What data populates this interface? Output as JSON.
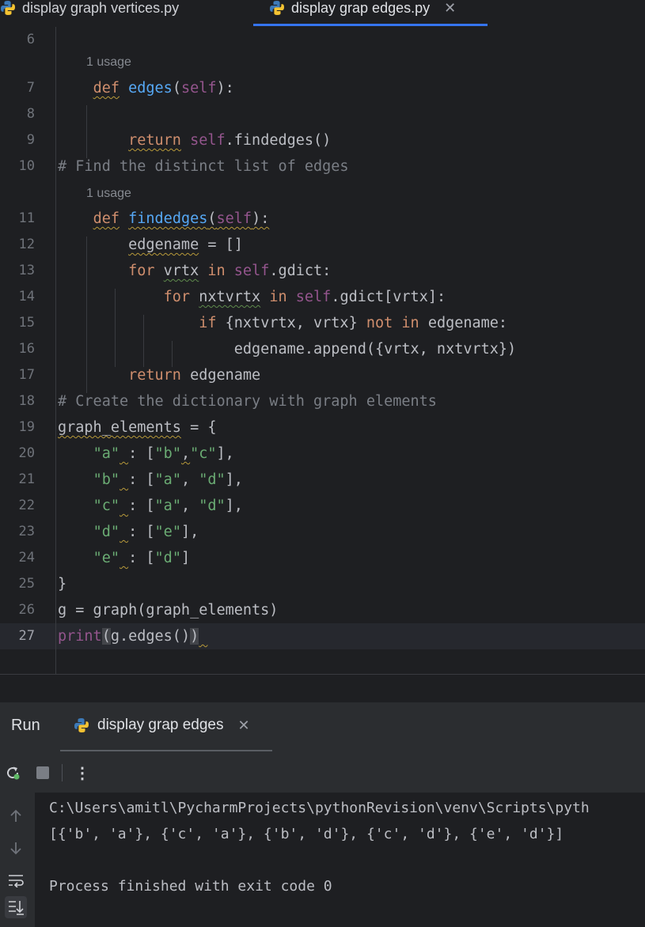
{
  "tabs": [
    {
      "label": "display graph vertices.py"
    },
    {
      "label": "display grap edges.py",
      "active": true
    }
  ],
  "editor": {
    "usage_hint": "1 usage",
    "line_numbers": [
      "6",
      "7",
      "8",
      "9",
      "10",
      "11",
      "12",
      "13",
      "14",
      "15",
      "16",
      "17",
      "18",
      "19",
      "20",
      "21",
      "22",
      "23",
      "24",
      "25",
      "26",
      "27"
    ],
    "comments": {
      "c10": "# Find the distinct list of edges",
      "c18": "# Create the dictionary with graph elements"
    }
  },
  "run_panel": {
    "title": "Run",
    "tab_label": "display grap edges",
    "output": [
      "C:\\Users\\amitl\\PycharmProjects\\pythonRevision\\venv\\Scripts\\pyth",
      "[{'b', 'a'}, {'c', 'a'}, {'b', 'd'}, {'c', 'd'}, {'e', 'd'}]",
      "",
      "Process finished with exit code 0"
    ]
  },
  "colors": {
    "background": "#1e1f22",
    "keyword": "#cf8e6d",
    "function": "#56a8f5",
    "self": "#94558d",
    "string": "#6aab73",
    "comment": "#7a7e85",
    "accent": "#3574f0"
  },
  "icons": [
    "python-file-icon",
    "close-icon",
    "rerun-icon",
    "stop-icon",
    "more-icon",
    "up-arrow-icon",
    "down-arrow-icon",
    "soft-wrap-icon",
    "scroll-to-end-icon"
  ]
}
